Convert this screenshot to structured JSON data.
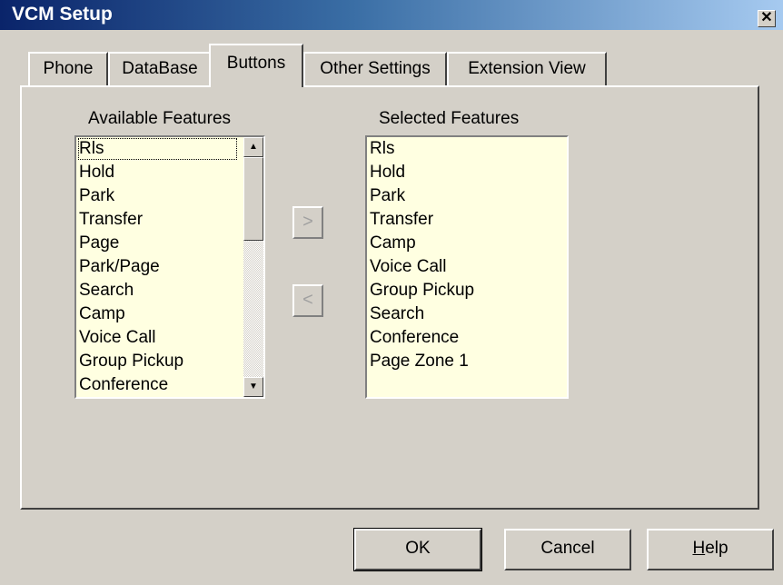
{
  "window": {
    "title": "VCM Setup"
  },
  "tabs": [
    {
      "label": "Phone"
    },
    {
      "label": "DataBase"
    },
    {
      "label": "Buttons"
    },
    {
      "label": "Other Settings"
    },
    {
      "label": "Extension View"
    }
  ],
  "active_tab": "Buttons",
  "available": {
    "label": "Available Features",
    "items": [
      "Rls",
      "Hold",
      "Park",
      "Transfer",
      "Page",
      "Park/Page",
      "Search",
      "Camp",
      "Voice Call",
      "Group Pickup",
      "Conference"
    ]
  },
  "selected": {
    "label": "Selected Features",
    "items": [
      "Rls",
      "Hold",
      "Park",
      "Transfer",
      "Camp",
      "Voice Call",
      "Group Pickup",
      "Search",
      "Conference",
      "Page Zone 1"
    ]
  },
  "move": {
    "add_label": ">",
    "remove_label": "<"
  },
  "buttons": {
    "ok": "OK",
    "cancel": "Cancel",
    "help_first": "H",
    "help_rest": "elp"
  },
  "icons": {
    "close": "close-icon",
    "scroll_up": "arrow-up-icon",
    "scroll_down": "arrow-down-icon"
  }
}
